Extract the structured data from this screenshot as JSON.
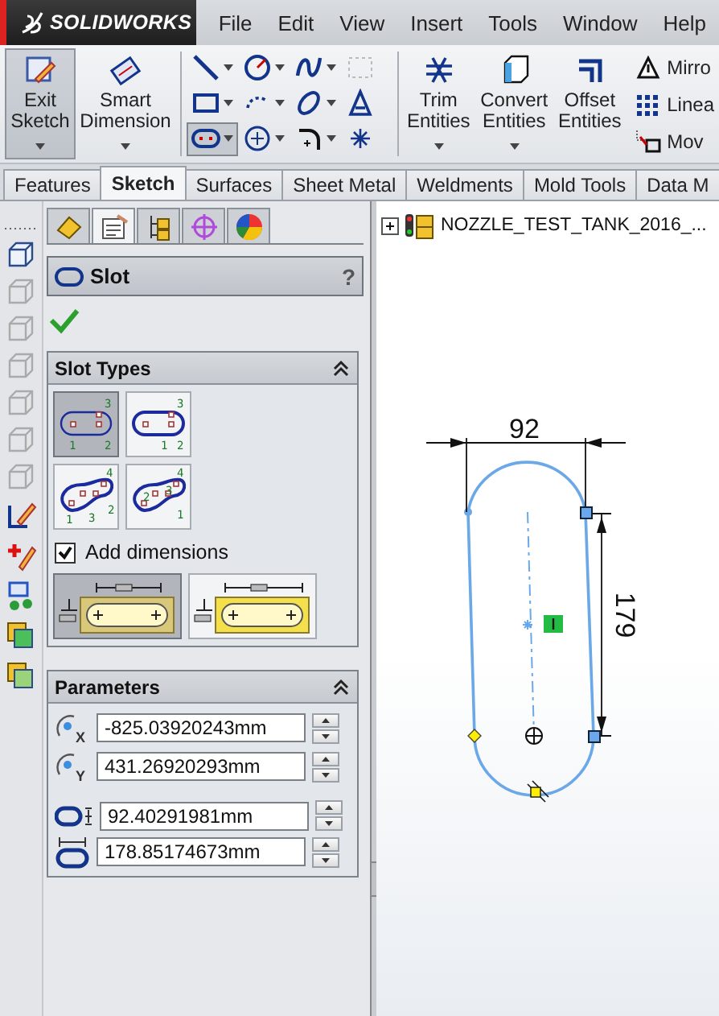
{
  "app": {
    "logo": "SOLIDWORKS"
  },
  "menu": [
    "File",
    "Edit",
    "View",
    "Insert",
    "Tools",
    "Window",
    "Help"
  ],
  "ribbon": {
    "large_buttons": [
      {
        "label": "Exit Sketch",
        "kind": "exit",
        "selected": true
      },
      {
        "label": "Smart Dimension",
        "kind": "dimension",
        "selected": false
      }
    ],
    "tools": [
      {
        "kind": "line",
        "selected": false
      },
      {
        "kind": "circle",
        "selected": false
      },
      {
        "kind": "spline",
        "selected": false
      },
      {
        "kind": "grid",
        "selected": false
      },
      {
        "kind": "rectangle",
        "selected": false
      },
      {
        "kind": "arc",
        "selected": false
      },
      {
        "kind": "ellipse",
        "selected": false
      },
      {
        "kind": "text",
        "selected": false
      },
      {
        "kind": "slot",
        "selected": true
      },
      {
        "kind": "polygon",
        "selected": false
      },
      {
        "kind": "fillet",
        "selected": false
      },
      {
        "kind": "point",
        "selected": false
      }
    ],
    "edit_buttons": [
      {
        "label": "Trim Entities",
        "kind": "trim"
      },
      {
        "label": "Convert Entities",
        "kind": "convert"
      },
      {
        "label": "Offset Entities",
        "kind": "offset"
      }
    ],
    "side_items": [
      {
        "label": "Mirro",
        "kind": "mirror"
      },
      {
        "label": "Linea",
        "kind": "linear"
      },
      {
        "label": "Mov",
        "kind": "move"
      }
    ]
  },
  "tabs": [
    {
      "label": "Features",
      "selected": false
    },
    {
      "label": "Sketch",
      "selected": true
    },
    {
      "label": "Surfaces",
      "selected": false
    },
    {
      "label": "Sheet Metal",
      "selected": false
    },
    {
      "label": "Weldments",
      "selected": false
    },
    {
      "label": "Mold Tools",
      "selected": false
    },
    {
      "label": "Data M",
      "selected": false
    }
  ],
  "panel_tabs": [
    {
      "kind": "feature",
      "selected": false
    },
    {
      "kind": "property",
      "selected": true
    },
    {
      "kind": "config",
      "selected": false
    },
    {
      "kind": "dimxpert",
      "selected": false
    },
    {
      "kind": "display",
      "selected": false
    }
  ],
  "property_manager": {
    "title": "Slot",
    "help": "?"
  },
  "slot_types": {
    "title": "Slot Types",
    "expanded": true,
    "options": [
      {
        "kind": "straight",
        "selected": true,
        "labels": [
          "3",
          "1",
          "2"
        ]
      },
      {
        "kind": "straight-center",
        "selected": false,
        "labels": [
          "3",
          "1",
          "2"
        ]
      },
      {
        "kind": "arc-3pt",
        "selected": false,
        "labels": [
          "4",
          "1",
          "3",
          "2"
        ]
      },
      {
        "kind": "arc-center",
        "selected": false,
        "labels": [
          "4",
          "2",
          "3",
          "1"
        ]
      }
    ],
    "add_dimensions": {
      "label": "Add dimensions",
      "checked": true
    },
    "dimension_styles": [
      {
        "kind": "center",
        "selected": true
      },
      {
        "kind": "overall",
        "selected": false
      }
    ]
  },
  "parameters": {
    "title": "Parameters",
    "expanded": true,
    "fields": [
      {
        "kind": "x",
        "icon_label": "X",
        "value": "-825.03920243mm"
      },
      {
        "kind": "y",
        "icon_label": "Y",
        "value": "431.26920293mm"
      },
      {
        "kind": "width",
        "value": "92.40291981mm"
      },
      {
        "kind": "length",
        "value": "178.85174673mm"
      }
    ]
  },
  "tree": {
    "label": "NOZZLE_TEST_TANK_2016_...",
    "expanded": false
  },
  "sketch": {
    "width_dimension": "92",
    "length_dimension": "179"
  }
}
